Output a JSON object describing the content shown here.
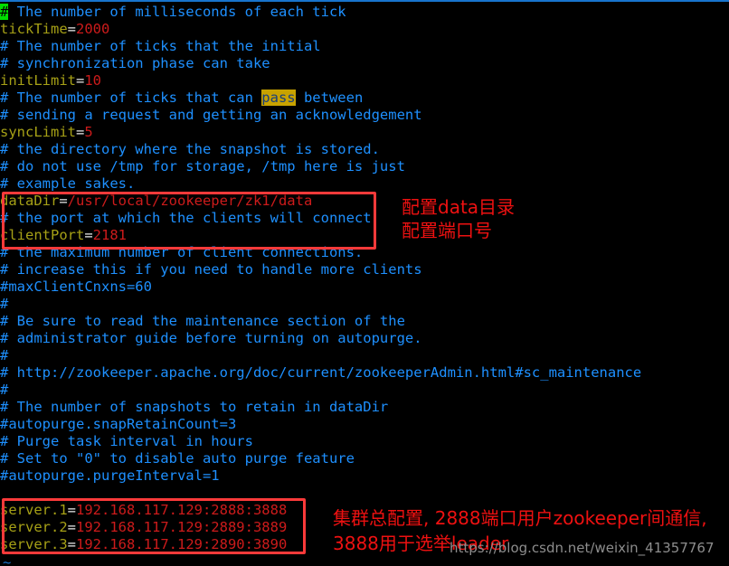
{
  "editor": {
    "kind": "terminal-text-editor",
    "file_contents_note": "zookeeper zoo.cfg configuration file shown in a dark terminal",
    "cursor_char": "#",
    "search_highlight_word": "pass",
    "tilde_filler": "~"
  },
  "colors": {
    "background": "#000000",
    "comment": "#1e90ff",
    "key": "#a6a016",
    "equals": "#e8e8e8",
    "value": "#cd1b1b",
    "search_highlight_bg": "#c8a200",
    "cursor_bg": "#00dd00",
    "annotation_red": "#ee1111",
    "box_red": "#fc3a3a",
    "watermark_gray": "#8d8d8d",
    "top_rule_blue": "#1874cd"
  },
  "lines": [
    {
      "type": "comment",
      "text": "# The number of milliseconds of each tick",
      "cursor": true
    },
    {
      "type": "setting",
      "key": "tickTime",
      "value": "2000"
    },
    {
      "type": "comment",
      "text": "# The number of ticks that the initial"
    },
    {
      "type": "comment",
      "text": "# synchronization phase can take"
    },
    {
      "type": "setting",
      "key": "initLimit",
      "value": "10"
    },
    {
      "type": "comment",
      "text": "# The number of ticks that can pass between",
      "highlight": "pass"
    },
    {
      "type": "comment",
      "text": "# sending a request and getting an acknowledgement"
    },
    {
      "type": "setting",
      "key": "syncLimit",
      "value": "5"
    },
    {
      "type": "comment",
      "text": "# the directory where the snapshot is stored."
    },
    {
      "type": "comment",
      "text": "# do not use /tmp for storage, /tmp here is just"
    },
    {
      "type": "comment",
      "text": "# example sakes."
    },
    {
      "type": "setting",
      "key": "dataDir",
      "value": "/usr/local/zookeeper/zk1/data"
    },
    {
      "type": "comment",
      "text": "# the port at which the clients will connect"
    },
    {
      "type": "setting",
      "key": "clientPort",
      "value": "2181"
    },
    {
      "type": "comment",
      "text": "# the maximum number of client connections."
    },
    {
      "type": "comment",
      "text": "# increase this if you need to handle more clients"
    },
    {
      "type": "comment",
      "text": "#maxClientCnxns=60"
    },
    {
      "type": "comment",
      "text": "#"
    },
    {
      "type": "comment",
      "text": "# Be sure to read the maintenance section of the"
    },
    {
      "type": "comment",
      "text": "# administrator guide before turning on autopurge."
    },
    {
      "type": "comment",
      "text": "#"
    },
    {
      "type": "comment",
      "text": "# http://zookeeper.apache.org/doc/current/zookeeperAdmin.html#sc_maintenance"
    },
    {
      "type": "comment",
      "text": "#"
    },
    {
      "type": "comment",
      "text": "# The number of snapshots to retain in dataDir"
    },
    {
      "type": "comment",
      "text": "#autopurge.snapRetainCount=3"
    },
    {
      "type": "comment",
      "text": "# Purge task interval in hours"
    },
    {
      "type": "comment",
      "text": "# Set to \"0\" to disable auto purge feature"
    },
    {
      "type": "comment",
      "text": "#autopurge.purgeInterval=1"
    },
    {
      "type": "blank",
      "text": ""
    },
    {
      "type": "setting",
      "key": "server.1",
      "value": "192.168.117.129:2888:3888"
    },
    {
      "type": "setting",
      "key": "server.2",
      "value": "192.168.117.129:2889:3889"
    },
    {
      "type": "setting",
      "key": "server.3",
      "value": "192.168.117.129:2890:3890"
    }
  ],
  "annotations": {
    "datadir_note": "配置data目录\n配置端口号",
    "cluster_note": "集群总配置, 2888端口用户zookeeper间通信, 3888用于选举leader"
  },
  "watermark": {
    "text": "https://blog.csdn.net/weixin_41357767"
  }
}
